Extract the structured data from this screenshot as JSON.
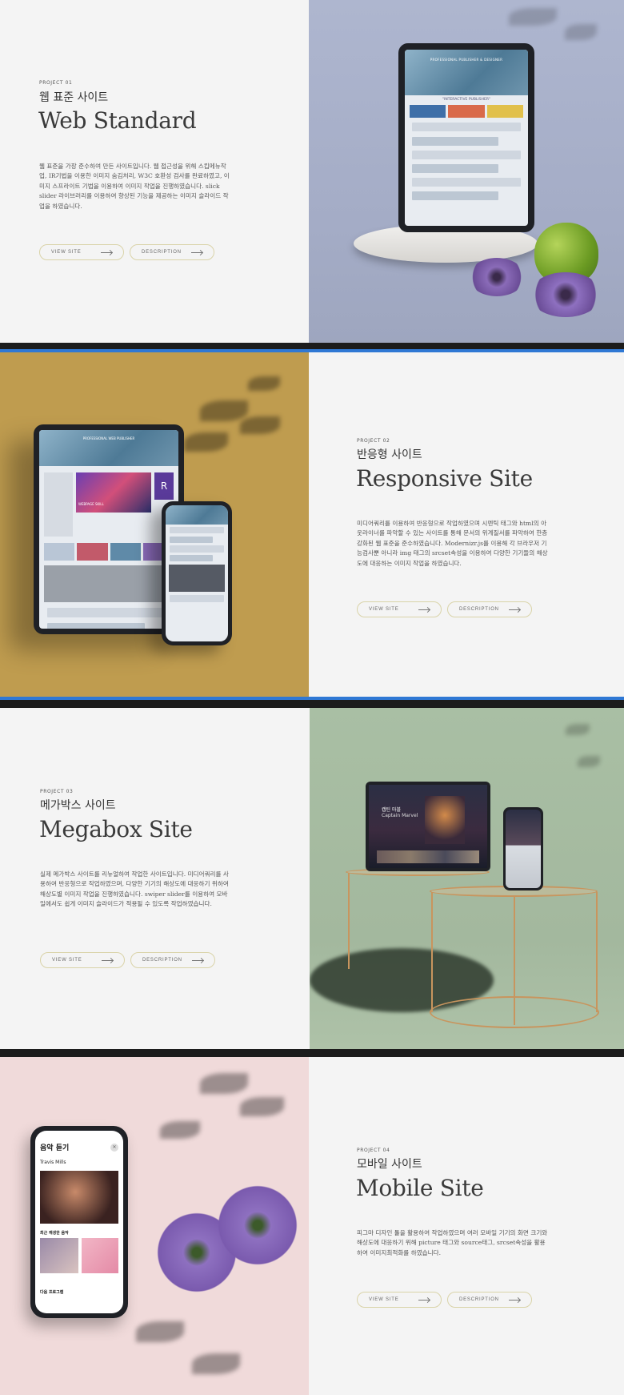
{
  "projects": [
    {
      "label": "PROJECT 01",
      "title_kr": "웹 표준 사이트",
      "title_en": "Web Standard",
      "description": "웹 표준을 가장 준수하여 만든 사이트입니다. 웹 접근성을 위해 스킵메뉴작업, IR기법을 이용한 이미지 숨김처리, W3C 호환성 검사를 완료하였고, 이미지 스프라이트 기법을 이용하여 이미지 작업을 진행하였습니다. slick slider 라이브러리를 이용하여 향상된 기능을 제공하는 이미지 슬라이드 작업을 하였습니다.",
      "view_site": "VIEW SITE",
      "description_btn": "DESCRIPTION",
      "screen_header": "PROFESSIONAL PUBLISHER & DESIGNER",
      "screen_tagline": "\"INTERACTIVE PUBLISHER\""
    },
    {
      "label": "PROJECT 02",
      "title_kr": "반응형 사이트",
      "title_en": "Responsive Site",
      "description": "미디어쿼리를 이용하여 반응형으로 작업하였으며 시멘틱 태그와 html의 아웃라이너를 파악할 수 있는 사이트를 통해 문서의 위계질서를 파악하여 한층 강화된 웹 표준을 준수하였습니다. Modernizr.js를 이용해 각 브라우저 기능검사뿐 아니라 img 태그의 srcset속성을 이용하여 다양한 기기들의 해상도에 대응하는 이미지 작업을 하였습니다.",
      "view_site": "VIEW SITE",
      "description_btn": "DESCRIPTION",
      "screen_header": "PROFESSIONAL WEB PUBLISHER",
      "screen_banner": "WEBPAGE SKILL",
      "screen_badge": "R"
    },
    {
      "label": "PROJECT 03",
      "title_kr": "메가박스 사이트",
      "title_en": "Megabox Site",
      "description": "실제 메가박스 사이트를 리뉴얼하여 작업한 사이트입니다. 미디어쿼리를 사용하여 반응형으로 작업하였으며, 다양한 기기의 해상도에 대응하기 위하여 해상도별 이미지 작업을 진행하였습니다. swiper slider를 이용하여 모바일에서도 쉽게 이미지 슬라이드가 적용될 수 있도록 작업하였습니다.",
      "view_site": "VIEW SITE",
      "description_btn": "DESCRIPTION",
      "screen_title": "캡틴 마블",
      "screen_subtitle": "Captain Marvel"
    },
    {
      "label": "PROJECT 04",
      "title_kr": "모바일 사이트",
      "title_en": "Mobile Site",
      "description": "피그마 디자인 툴을 활용하여 작업하였으며 여러 모바일 기기의 화면 크기와 해상도에 대응하기 위해 picture 태그와 source태그, srcset속성을 활용하여 이미지최적화를 하였습니다.",
      "view_site": "VIEW SITE",
      "description_btn": "DESCRIPTION",
      "app_title": "음악 듣기",
      "app_artist": "Travis Mills",
      "app_section1": "최근 재생한 음악",
      "app_section2": "다음 프로그램"
    }
  ],
  "colors": {
    "panel_bg": "#f4f4f4",
    "p1_bg": "#a8b0c9",
    "p2_bg": "#bf9c4f",
    "p3_bg": "#a8bea3",
    "p4_bg": "#f0dada",
    "divider_dark": "#1c1c1c",
    "divider_blue": "#2f78d4"
  }
}
